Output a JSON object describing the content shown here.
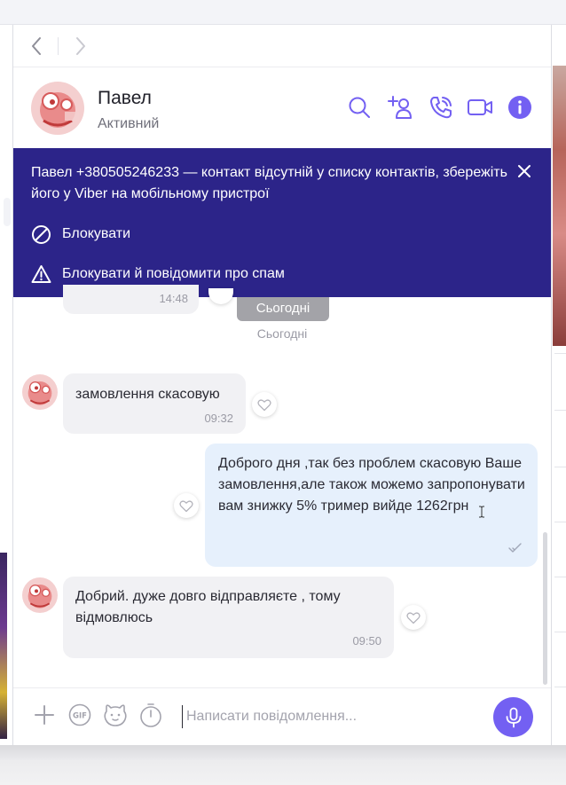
{
  "nav": {
    "back": "back-arrow",
    "forward": "forward-arrow"
  },
  "contact": {
    "name": "Павел",
    "status": "Активний"
  },
  "header_icons": [
    "search-icon",
    "add-participant-icon",
    "phone-icon",
    "video-icon",
    "info-icon"
  ],
  "banner": {
    "text": "Павел +380505246233 — контакт відсутній у списку контактів, збережіть його у Viber на мобільному пристрої",
    "block_label": "Блокувати",
    "block_spam_label": "Блокувати й повідомити про спам"
  },
  "chat": {
    "partial_prev_time": "14:48",
    "date_pill": "Сьогодні",
    "date_label": "Сьогодні",
    "messages": [
      {
        "direction": "in",
        "text": "замовлення скасовую",
        "time": "09:32"
      },
      {
        "direction": "out",
        "text": "Доброго дня ,так без проблем скасовую Ваше замовлення,але також можемо запропонувати вам знижку 5% тример вийде 1262грн",
        "time": ""
      },
      {
        "direction": "in",
        "text": "Добрий. дуже довго відправляєте , тому відмовлюсь",
        "time": "09:50"
      }
    ]
  },
  "composer": {
    "placeholder": "Написати повідомлення..."
  },
  "colors": {
    "accent": "#7360f2",
    "banner": "#2c2489",
    "incoming_bubble": "#f1f1f4",
    "outgoing_bubble": "#e6f0fc"
  }
}
